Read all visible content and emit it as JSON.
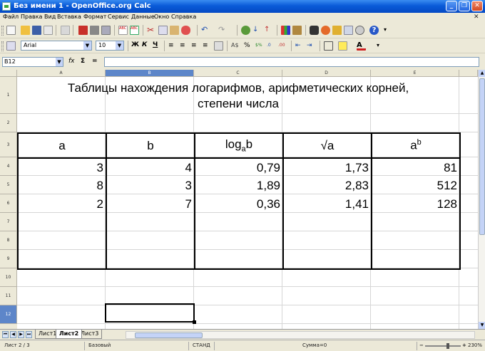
{
  "window": {
    "title": "Без имени 1 - OpenOffice.org Calc"
  },
  "menu": [
    "Файл",
    "Правка",
    "Вид",
    "Вставка",
    "Формат",
    "Сервис",
    "Данные",
    "Окно",
    "Справка"
  ],
  "toolbar2": {
    "font_name": "Arial",
    "font_size": "10",
    "bold": "Ж",
    "italic": "К",
    "underline": "Ч"
  },
  "formula_bar": {
    "cell_ref": "B12",
    "fx": "fx",
    "sum": "Σ",
    "equals": "="
  },
  "columns": [
    "A",
    "B",
    "C",
    "D",
    "E"
  ],
  "rows": [
    "1",
    "2",
    "3",
    "4",
    "5",
    "6",
    "7",
    "8",
    "9",
    "10",
    "11",
    "12"
  ],
  "sheet": {
    "title_line1": "Таблицы нахождения логарифмов, арифметических корней,",
    "title_line2": "степени числа",
    "headers": {
      "a": "a",
      "b": "b",
      "log_main": "log",
      "log_sub": "a",
      "log_arg": "b",
      "sqrt": "√a",
      "pow_base": "a",
      "pow_exp": "b"
    },
    "data": [
      [
        "3",
        "4",
        "0,79",
        "1,73",
        "81"
      ],
      [
        "8",
        "3",
        "1,89",
        "2,83",
        "512"
      ],
      [
        "2",
        "7",
        "0,36",
        "1,41",
        "128"
      ],
      [
        "",
        "",
        "",
        "",
        ""
      ],
      [
        "",
        "",
        "",
        "",
        ""
      ],
      [
        "",
        "",
        "",
        "",
        ""
      ]
    ]
  },
  "sheet_tabs": [
    "Лист1",
    "Лист2",
    "Лист3"
  ],
  "status": {
    "sheet": "Лист 2 / 3",
    "style": "Базовый",
    "mode": "СТАНД",
    "sum": "Сумма=0",
    "zoom": "230%"
  }
}
